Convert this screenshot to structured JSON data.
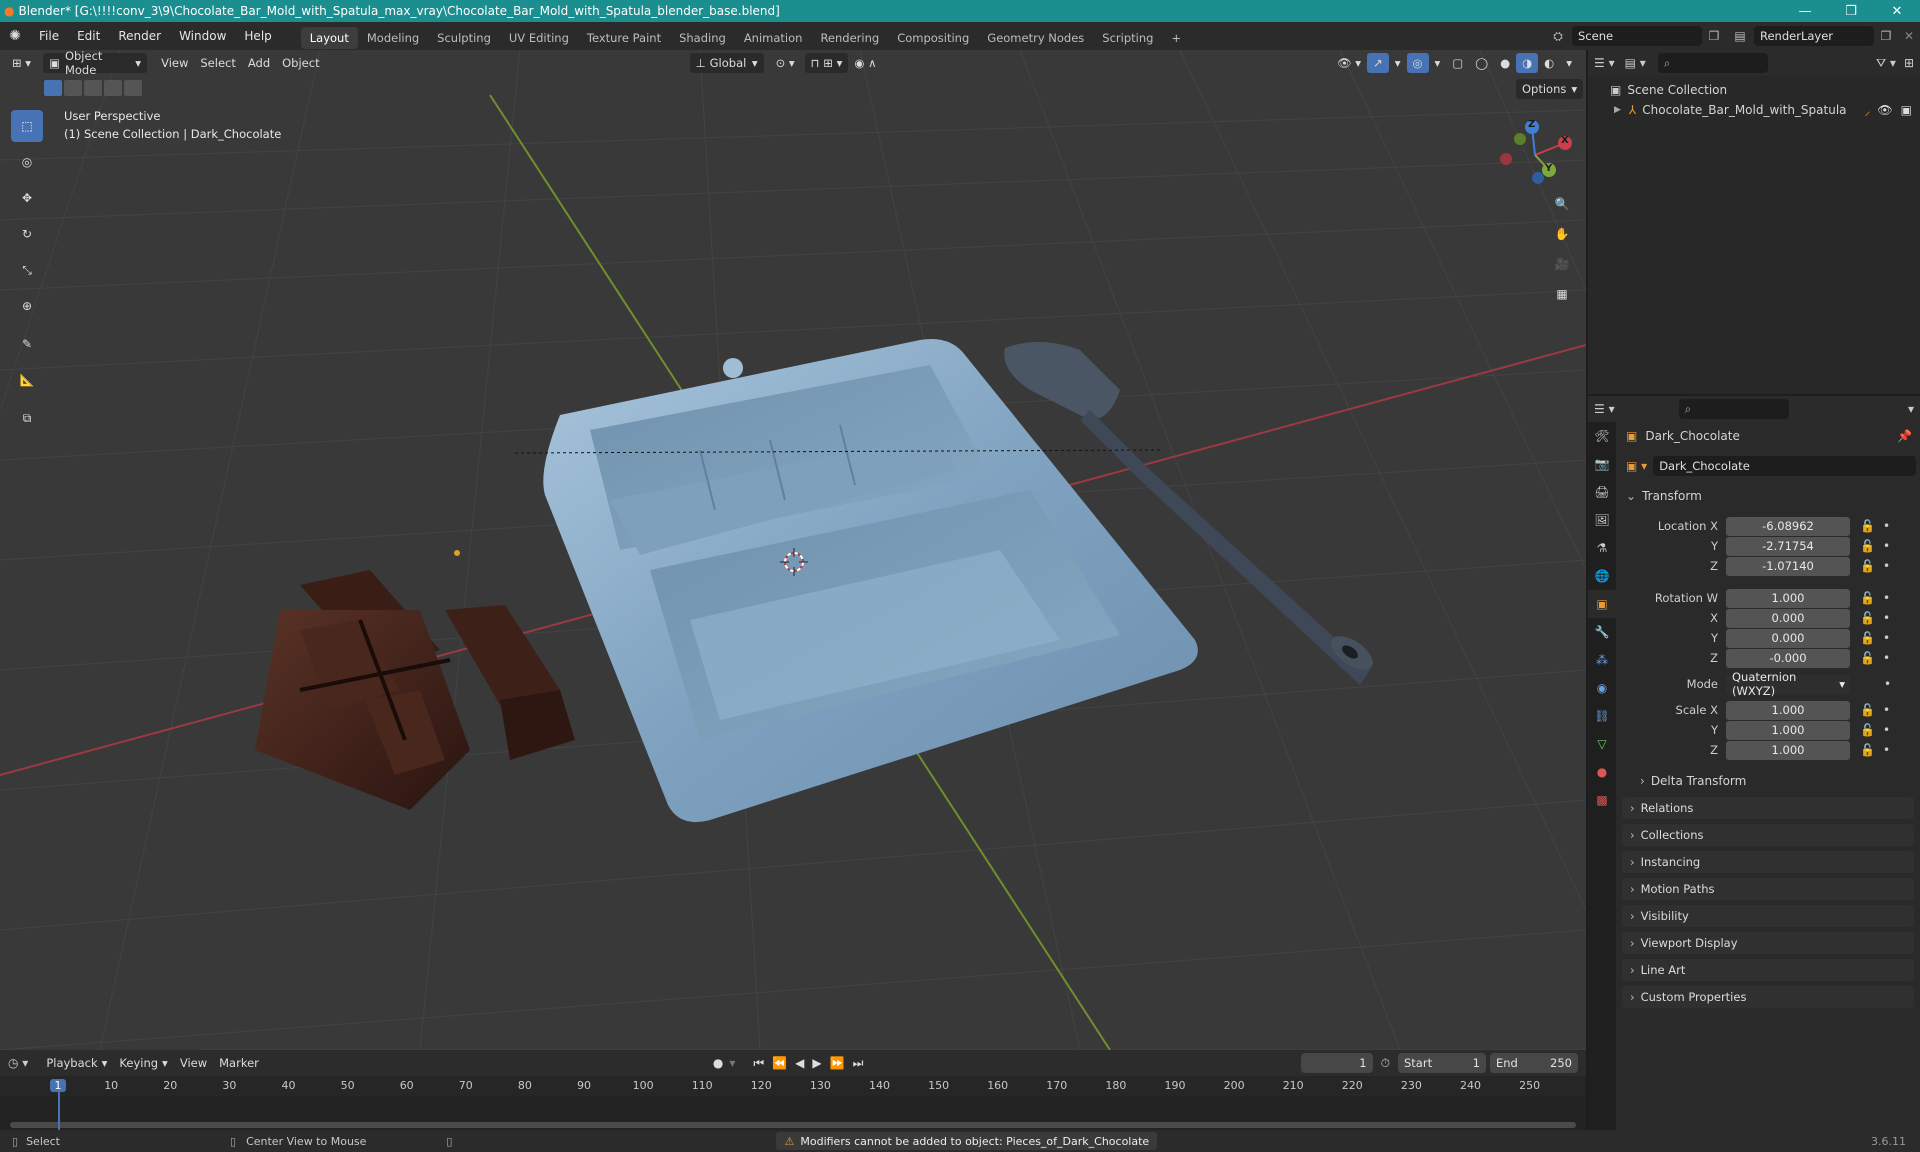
{
  "title_bar": {
    "title": "Blender* [G:\\!!!!conv_3\\9\\Chocolate_Bar_Mold_with_Spatula_max_vray\\Chocolate_Bar_Mold_with_Spatula_blender_base.blend]",
    "minimize": "—",
    "maximize": "❐",
    "close": "✕"
  },
  "menu": {
    "items": [
      "File",
      "Edit",
      "Render",
      "Window",
      "Help"
    ]
  },
  "workspaces": {
    "tabs": [
      "Layout",
      "Modeling",
      "Sculpting",
      "UV Editing",
      "Texture Paint",
      "Shading",
      "Animation",
      "Rendering",
      "Compositing",
      "Geometry Nodes",
      "Scripting"
    ],
    "active": "Layout",
    "add": "+"
  },
  "scene_selector": {
    "value": "Scene"
  },
  "render_layer": {
    "value": "RenderLayer"
  },
  "viewport_header": {
    "mode": "Object Mode",
    "menus": [
      "View",
      "Select",
      "Add",
      "Object"
    ],
    "orientation": "Global",
    "options": "Options"
  },
  "viewport_overlay": {
    "perspective": "User Perspective",
    "collection_info": "(1) Scene Collection | Dark_Chocolate"
  },
  "gizmo": {
    "x": "X",
    "y": "Y",
    "z": "Z"
  },
  "outliner": {
    "root": "Scene Collection",
    "items": [
      {
        "name": "Chocolate_Bar_Mold_with_Spatula"
      }
    ]
  },
  "properties": {
    "object_name": "Dark_Chocolate",
    "datablock": "Dark_Chocolate",
    "transform_title": "Transform",
    "location": {
      "label": "Location X",
      "x": "-6.08962",
      "y": "-2.71754",
      "z": "-1.07140"
    },
    "rotation": {
      "label": "Rotation W",
      "w": "1.000",
      "x": "0.000",
      "y": "0.000",
      "z": "-0.000"
    },
    "mode": {
      "label": "Mode",
      "value": "Quaternion (WXYZ)"
    },
    "scale": {
      "label": "Scale X",
      "x": "1.000",
      "y": "1.000",
      "z": "1.000"
    },
    "axis_labels": {
      "x": "X",
      "y": "Y",
      "z": "Z"
    },
    "delta_transform": "Delta Transform",
    "panels": [
      "Relations",
      "Collections",
      "Instancing",
      "Motion Paths",
      "Visibility",
      "Viewport Display",
      "Line Art",
      "Custom Properties"
    ]
  },
  "timeline": {
    "menus": [
      "Playback",
      "Keying",
      "View",
      "Marker"
    ],
    "current_frame": "1",
    "start_label": "Start",
    "start": "1",
    "end_label": "End",
    "end": "250",
    "ruler": [
      "1",
      "10",
      "20",
      "30",
      "40",
      "50",
      "60",
      "70",
      "80",
      "90",
      "100",
      "110",
      "120",
      "130",
      "140",
      "150",
      "160",
      "170",
      "180",
      "190",
      "200",
      "210",
      "220",
      "230",
      "240",
      "250"
    ]
  },
  "status": {
    "select": "Select",
    "center_view": "Center View to Mouse",
    "warning": "Modifiers cannot be added to object: Pieces_of_Dark_Chocolate",
    "version": "3.6.11"
  },
  "colors": {
    "titlebar": "#1b8f8f",
    "accent": "#4772b3",
    "x_axis": "#c9404a",
    "y_axis": "#7fa93a",
    "z_axis": "#3f7fd6",
    "warning": "#e1a02b"
  }
}
